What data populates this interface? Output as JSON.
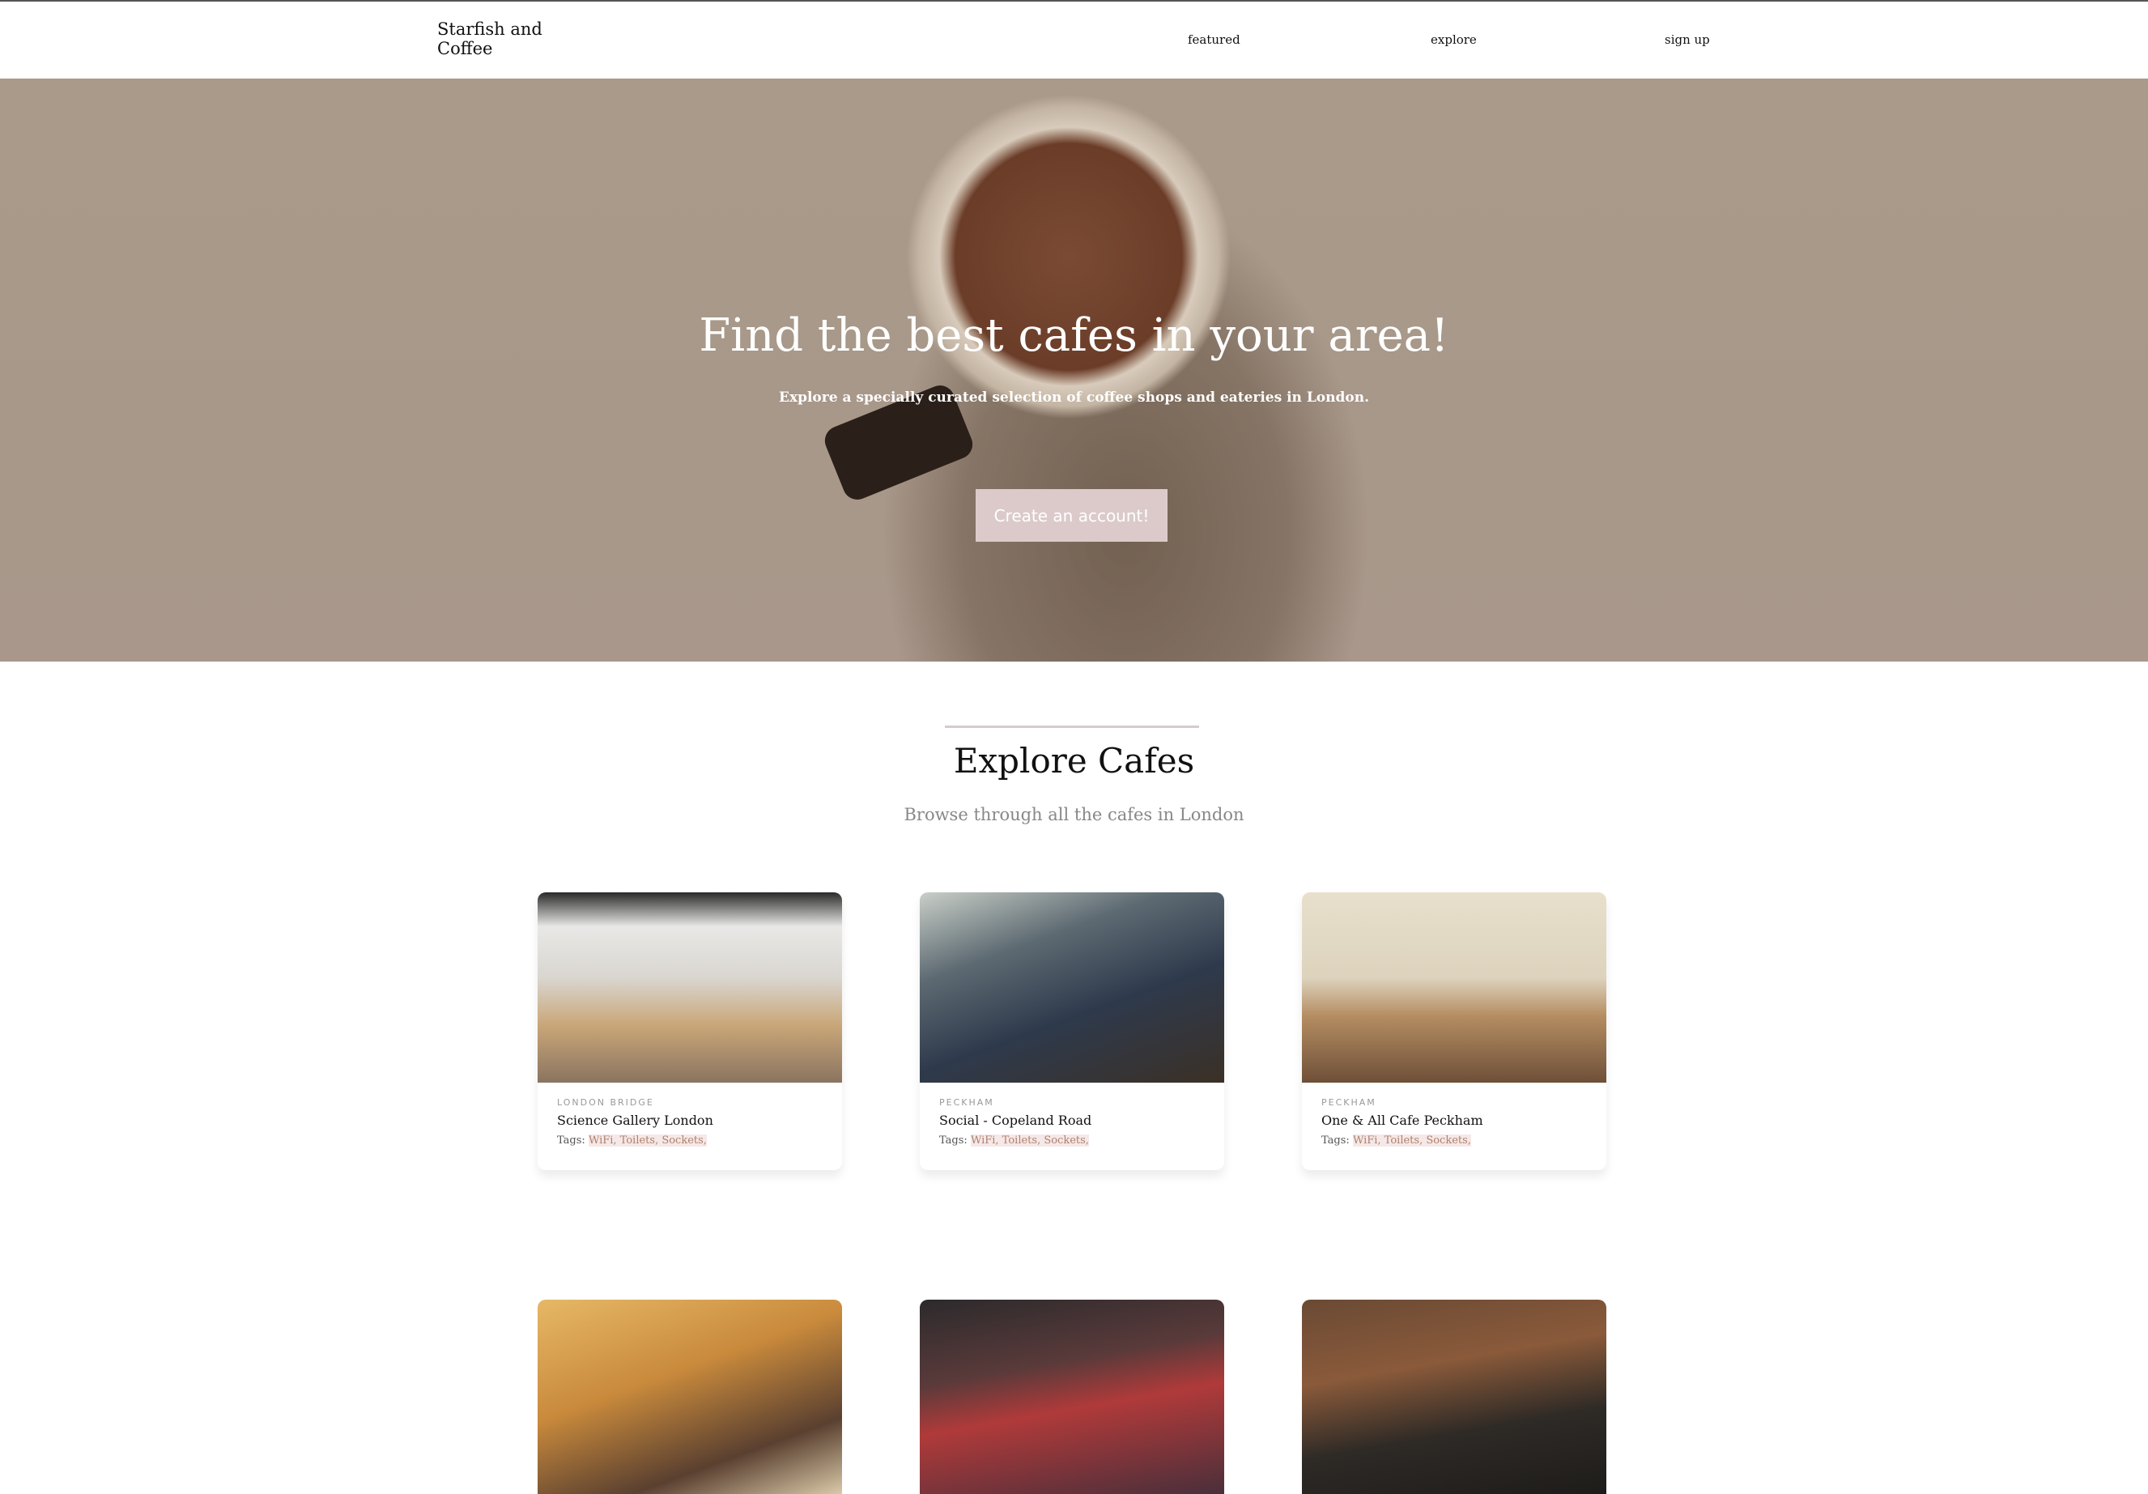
{
  "header": {
    "logo": "Starfish and Coffee",
    "nav": [
      {
        "label": "featured"
      },
      {
        "label": "explore"
      },
      {
        "label": "sign up"
      }
    ]
  },
  "hero": {
    "title": "Find the best cafes in your area!",
    "subtitle": "Explore a specially curated selection of coffee shops and eateries in London.",
    "cta": "Create an account!"
  },
  "explore": {
    "title": "Explore Cafes",
    "subtitle": "Browse through all the cafes in London"
  },
  "cafes": [
    {
      "location": "LONDON BRIDGE",
      "name": "Science Gallery London",
      "tags_label": "Tags:",
      "tags": "WiFi, Toilets, Sockets,"
    },
    {
      "location": "PECKHAM",
      "name": "Social - Copeland Road",
      "tags_label": "Tags:",
      "tags": "WiFi, Toilets, Sockets,"
    },
    {
      "location": "PECKHAM",
      "name": "One & All Cafe Peckham",
      "tags_label": "Tags:",
      "tags": "WiFi, Toilets, Sockets,"
    }
  ],
  "colors": {
    "hero_bg": "#a99a89",
    "button": "#dccacb",
    "tag_bg": "#f5e8e8",
    "tag_text": "#b0806a"
  }
}
